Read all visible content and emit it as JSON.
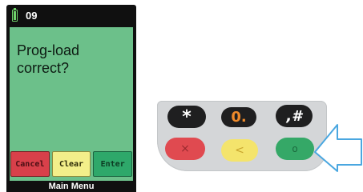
{
  "status_bar": {
    "number": "09",
    "battery_icon": "battery-icon"
  },
  "display": {
    "prompt": "Prog-load\ncorrect?",
    "background": "#6cc08a"
  },
  "softkeys": [
    {
      "label": "Cancel",
      "color": "#d8404a"
    },
    {
      "label": "Clear",
      "color": "#f3ef8a"
    },
    {
      "label": "Enter",
      "color": "#2ea86a"
    }
  ],
  "footer": {
    "label": "Main Menu"
  },
  "keypad": {
    "star_label": "*",
    "zero_label": "0.",
    "hash_label": ",#",
    "cancel_key_symbol": "×",
    "clear_key_symbol": "<",
    "enter_key_symbol": "o"
  },
  "highlight": {
    "icon": "arrow-left-icon",
    "color": "#4aa7e0"
  }
}
